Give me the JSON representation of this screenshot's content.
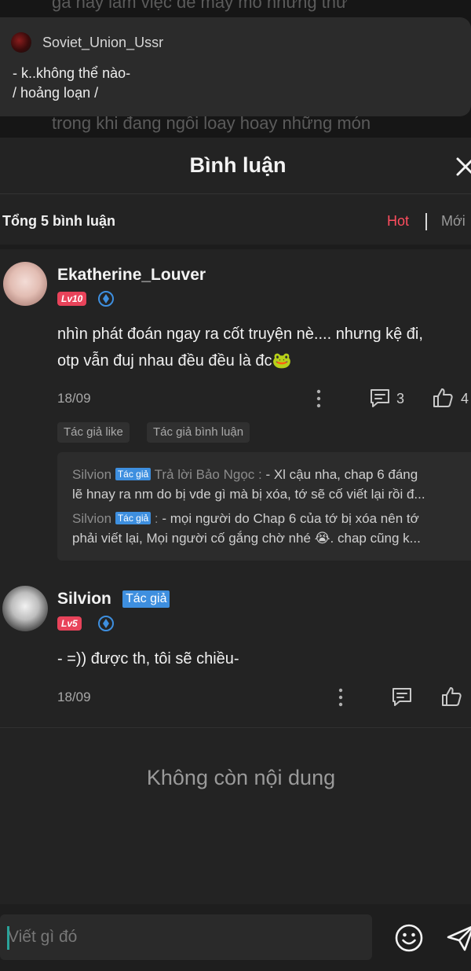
{
  "reader": {
    "bg_line_top": "gà này làm việc để mày mò những thứ",
    "bg_line_bottom": "trong khi đang ngồi loay hoay những món",
    "popup": {
      "username": "Soviet_Union_Ussr",
      "line1": "- k..không thể nào-",
      "line2": "/ hoảng loạn /"
    }
  },
  "sheet": {
    "title": "Bình luận",
    "total": "Tổng 5 bình luận",
    "sort_hot": "Hot",
    "sort_new": "Mới"
  },
  "comments": [
    {
      "username": "Ekatherine_Louver",
      "level": "Lv10",
      "text_line1": "nhìn phát đoán ngay ra cốt truyện nè.... nhưng kệ đi,",
      "text_line2": "otp vẫn đuj nhau đều đều là đc🐸",
      "date": "18/09",
      "reply_count": "3",
      "like_count": "4",
      "chips": [
        "Tác giả like",
        "Tác giả bình luận"
      ],
      "replies": [
        {
          "name": "Silvion",
          "tag": "Tác giả",
          "sub": "Trả lời Bảo Ngọc :",
          "line1_text": " - Xl cậu nha, chap 6 đáng",
          "line2_text": "lẽ hnay ra nm do bị vde gì mà bị xóa, tớ sẽ cố viết lại rồi đ..."
        },
        {
          "name": "Silvion",
          "tag": "Tác giả",
          "sub": ":",
          "line1_text": " - mọi người do Chap 6 của tớ bị xóa nên tớ",
          "line2_text": "phải viết lại, Mọi người cố gắng chờ nhé 😭. chap cũng k..."
        }
      ]
    },
    {
      "username": "Silvion",
      "author_tag": "Tác giả",
      "level": "Lv5",
      "text_line1": "- =)) được th, tôi sẽ chiều-",
      "date": "18/09"
    }
  ],
  "end_text": "Không còn nội dung",
  "compose": {
    "placeholder": "Viết gì đó"
  },
  "colors": {
    "accent_hot": "#ff4d5e",
    "level_badge": "#e8435a",
    "author_tag": "#3e8fdf",
    "verified": "#3e8fdf"
  },
  "icons": [
    "close-icon",
    "shield-icon",
    "dots-icon",
    "reply-icon",
    "like-icon",
    "emoji-icon",
    "send-icon"
  ]
}
